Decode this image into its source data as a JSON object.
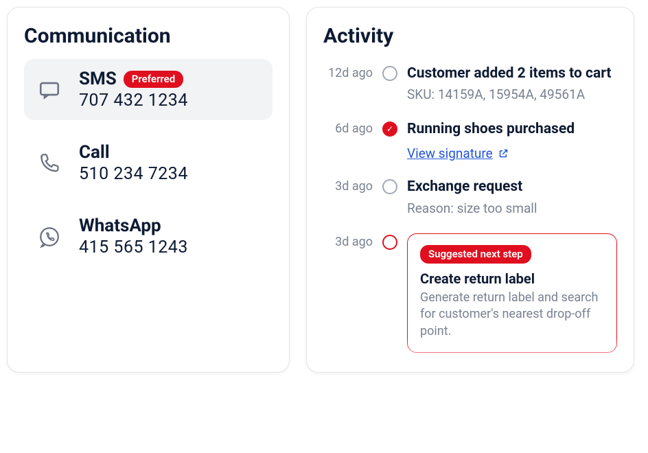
{
  "communication": {
    "title": "Communication",
    "preferred_label": "Preferred",
    "channels": [
      {
        "label": "SMS",
        "value": "707 432 1234",
        "preferred": true
      },
      {
        "label": "Call",
        "value": "510 234 7234",
        "preferred": false
      },
      {
        "label": "WhatsApp",
        "value": "415 565 1243",
        "preferred": false
      }
    ]
  },
  "activity": {
    "title": "Activity",
    "items": [
      {
        "time": "12d ago",
        "title": "Customer added 2 items to cart",
        "sub": "SKU: 14159A, 15954A, 49561A"
      },
      {
        "time": "6d ago",
        "title": "Running shoes purchased",
        "link": "View signature"
      },
      {
        "time": "3d ago",
        "title": "Exchange request",
        "sub": "Reason: size too small"
      }
    ],
    "suggestion": {
      "time": "3d ago",
      "badge": "Suggested next step",
      "title": "Create return label",
      "desc": "Generate return label and search for customer's nearest drop-off point."
    }
  }
}
